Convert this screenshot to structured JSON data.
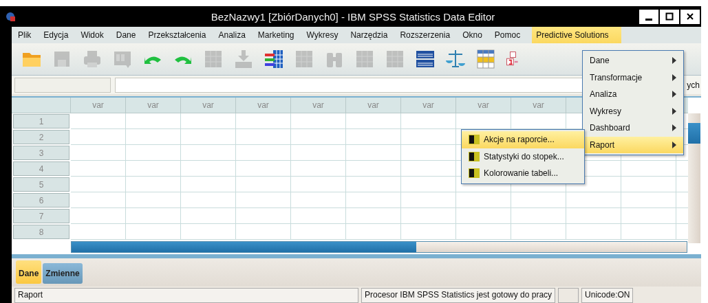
{
  "window": {
    "title": "BezNazwy1 [ZbiórDanych0] - IBM SPSS Statistics Data Editor"
  },
  "menu": [
    {
      "label": "Plik",
      "selected": false
    },
    {
      "label": "Edycja",
      "selected": false
    },
    {
      "label": "Widok",
      "selected": false
    },
    {
      "label": "Dane",
      "selected": false
    },
    {
      "label": "Przekształcenia",
      "selected": false
    },
    {
      "label": "Analiza",
      "selected": false
    },
    {
      "label": "Marketing",
      "selected": false
    },
    {
      "label": "Wykresy",
      "selected": false
    },
    {
      "label": "Narzędzia",
      "selected": false
    },
    {
      "label": "Rozszerzenia",
      "selected": false
    },
    {
      "label": "Okno",
      "selected": false
    },
    {
      "label": "Pomoc",
      "selected": false
    },
    {
      "label": "Predictive Solutions",
      "selected": true
    }
  ],
  "toolbar": [
    {
      "kind": "folder",
      "disabled": false
    },
    {
      "kind": "save",
      "disabled": true
    },
    {
      "kind": "print",
      "disabled": true
    },
    {
      "kind": "dialog",
      "disabled": true
    },
    {
      "kind": "undo",
      "disabled": false
    },
    {
      "kind": "redo",
      "disabled": false
    },
    {
      "kind": "grid",
      "disabled": true
    },
    {
      "kind": "download",
      "disabled": true
    },
    {
      "kind": "variables",
      "disabled": false
    },
    {
      "kind": "grid",
      "disabled": true
    },
    {
      "kind": "binoculars",
      "disabled": true
    },
    {
      "kind": "grid",
      "disabled": true
    },
    {
      "kind": "grid",
      "disabled": true
    },
    {
      "kind": "tables",
      "disabled": false
    },
    {
      "kind": "scale",
      "disabled": false
    },
    {
      "kind": "sheet",
      "disabled": false
    },
    {
      "kind": "labels",
      "disabled": false
    }
  ],
  "cell_editor": {
    "variable_info": "ych"
  },
  "grid": {
    "columns": [
      "var",
      "var",
      "var",
      "var",
      "var",
      "var",
      "var",
      "var",
      "var"
    ],
    "rows": [
      "1",
      "2",
      "3",
      "4",
      "5",
      "6",
      "7",
      "8"
    ]
  },
  "dropdown": {
    "items": [
      {
        "label": "Dane",
        "selected": false
      },
      {
        "label": "Transformacje",
        "selected": false
      },
      {
        "label": "Analiza",
        "selected": false
      },
      {
        "label": "Wykresy",
        "selected": false
      },
      {
        "label": "Dashboard",
        "selected": false
      },
      {
        "label": "Raport",
        "selected": true
      }
    ]
  },
  "submenu": {
    "items": [
      {
        "label": "Akcje na raporcie...",
        "selected": true
      },
      {
        "label": "Statystyki do stopek...",
        "selected": false
      },
      {
        "label": "Kolorowanie tabeli...",
        "selected": false
      }
    ]
  },
  "view_tabs": [
    {
      "label": "Dane",
      "selected": true
    },
    {
      "label": "Zmienne",
      "selected": false
    }
  ],
  "status_bar": {
    "left": "Raport",
    "processor": "Procesor IBM SPSS Statistics  jest gotowy do pracy",
    "unicode": "Unicode:ON"
  }
}
